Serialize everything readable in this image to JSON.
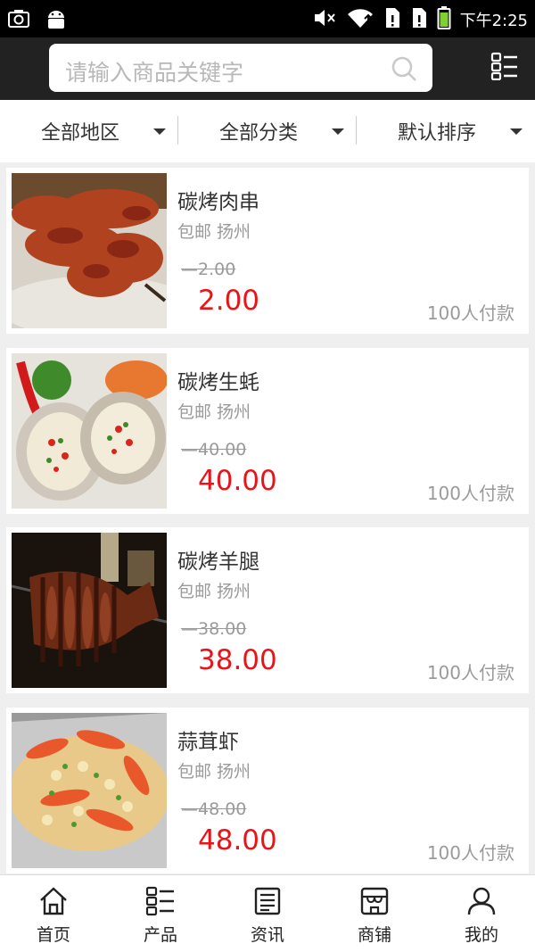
{
  "status_bar": {
    "time": "下午2:25",
    "icons": [
      "camera-icon",
      "android-icon",
      "mute-icon",
      "wifi-icon",
      "sim1-icon",
      "sim2-icon",
      "battery-icon"
    ]
  },
  "search": {
    "placeholder": "请输入商品关键字"
  },
  "filters": [
    {
      "label": "全部地区"
    },
    {
      "label": "全部分类"
    },
    {
      "label": "默认排序"
    }
  ],
  "products": [
    {
      "title": "碳烤肉串",
      "location": "包邮 扬州",
      "old_price": "2.00",
      "price": "2.00",
      "sold": "100人付款",
      "image": "skewer"
    },
    {
      "title": "碳烤生蚝",
      "location": "包邮 扬州",
      "old_price": "40.00",
      "price": "40.00",
      "sold": "100人付款",
      "image": "oyster"
    },
    {
      "title": "碳烤羊腿",
      "location": "包邮 扬州",
      "old_price": "38.00",
      "price": "38.00",
      "sold": "100人付款",
      "image": "lamb"
    },
    {
      "title": "蒜茸虾",
      "location": "包邮 扬州",
      "old_price": "48.00",
      "price": "48.00",
      "sold": "100人付款",
      "image": "shrimp"
    }
  ],
  "tabs": [
    {
      "label": "首页",
      "icon": "home-icon"
    },
    {
      "label": "产品",
      "icon": "grid-list-icon"
    },
    {
      "label": "资讯",
      "icon": "news-icon"
    },
    {
      "label": "商铺",
      "icon": "shop-icon"
    },
    {
      "label": "我的",
      "icon": "user-icon"
    }
  ],
  "colors": {
    "header_bg": "#222222",
    "price_red": "#e8141a",
    "muted_text": "#9a9a9a"
  }
}
